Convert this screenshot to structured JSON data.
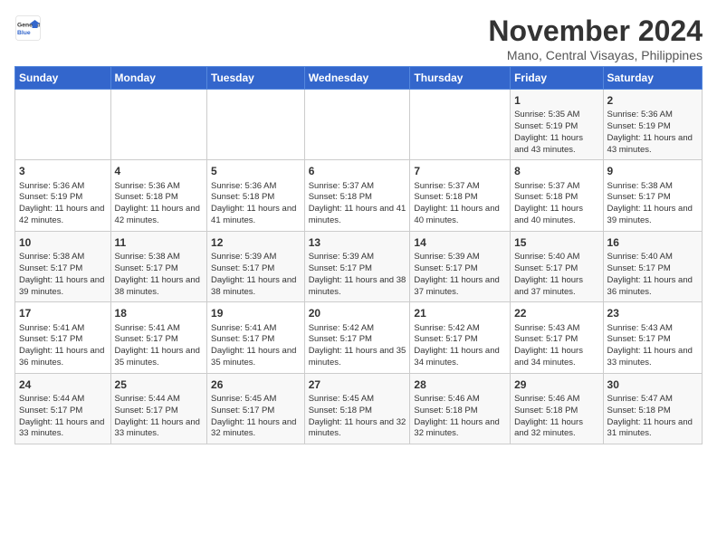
{
  "header": {
    "logo_text_general": "General",
    "logo_text_blue": "Blue",
    "month_title": "November 2024",
    "subtitle": "Mano, Central Visayas, Philippines"
  },
  "days_of_week": [
    "Sunday",
    "Monday",
    "Tuesday",
    "Wednesday",
    "Thursday",
    "Friday",
    "Saturday"
  ],
  "weeks": [
    [
      {
        "day": "",
        "info": ""
      },
      {
        "day": "",
        "info": ""
      },
      {
        "day": "",
        "info": ""
      },
      {
        "day": "",
        "info": ""
      },
      {
        "day": "",
        "info": ""
      },
      {
        "day": "1",
        "info": "Sunrise: 5:35 AM\nSunset: 5:19 PM\nDaylight: 11 hours and 43 minutes."
      },
      {
        "day": "2",
        "info": "Sunrise: 5:36 AM\nSunset: 5:19 PM\nDaylight: 11 hours and 43 minutes."
      }
    ],
    [
      {
        "day": "3",
        "info": "Sunrise: 5:36 AM\nSunset: 5:19 PM\nDaylight: 11 hours and 42 minutes."
      },
      {
        "day": "4",
        "info": "Sunrise: 5:36 AM\nSunset: 5:18 PM\nDaylight: 11 hours and 42 minutes."
      },
      {
        "day": "5",
        "info": "Sunrise: 5:36 AM\nSunset: 5:18 PM\nDaylight: 11 hours and 41 minutes."
      },
      {
        "day": "6",
        "info": "Sunrise: 5:37 AM\nSunset: 5:18 PM\nDaylight: 11 hours and 41 minutes."
      },
      {
        "day": "7",
        "info": "Sunrise: 5:37 AM\nSunset: 5:18 PM\nDaylight: 11 hours and 40 minutes."
      },
      {
        "day": "8",
        "info": "Sunrise: 5:37 AM\nSunset: 5:18 PM\nDaylight: 11 hours and 40 minutes."
      },
      {
        "day": "9",
        "info": "Sunrise: 5:38 AM\nSunset: 5:17 PM\nDaylight: 11 hours and 39 minutes."
      }
    ],
    [
      {
        "day": "10",
        "info": "Sunrise: 5:38 AM\nSunset: 5:17 PM\nDaylight: 11 hours and 39 minutes."
      },
      {
        "day": "11",
        "info": "Sunrise: 5:38 AM\nSunset: 5:17 PM\nDaylight: 11 hours and 38 minutes."
      },
      {
        "day": "12",
        "info": "Sunrise: 5:39 AM\nSunset: 5:17 PM\nDaylight: 11 hours and 38 minutes."
      },
      {
        "day": "13",
        "info": "Sunrise: 5:39 AM\nSunset: 5:17 PM\nDaylight: 11 hours and 38 minutes."
      },
      {
        "day": "14",
        "info": "Sunrise: 5:39 AM\nSunset: 5:17 PM\nDaylight: 11 hours and 37 minutes."
      },
      {
        "day": "15",
        "info": "Sunrise: 5:40 AM\nSunset: 5:17 PM\nDaylight: 11 hours and 37 minutes."
      },
      {
        "day": "16",
        "info": "Sunrise: 5:40 AM\nSunset: 5:17 PM\nDaylight: 11 hours and 36 minutes."
      }
    ],
    [
      {
        "day": "17",
        "info": "Sunrise: 5:41 AM\nSunset: 5:17 PM\nDaylight: 11 hours and 36 minutes."
      },
      {
        "day": "18",
        "info": "Sunrise: 5:41 AM\nSunset: 5:17 PM\nDaylight: 11 hours and 35 minutes."
      },
      {
        "day": "19",
        "info": "Sunrise: 5:41 AM\nSunset: 5:17 PM\nDaylight: 11 hours and 35 minutes."
      },
      {
        "day": "20",
        "info": "Sunrise: 5:42 AM\nSunset: 5:17 PM\nDaylight: 11 hours and 35 minutes."
      },
      {
        "day": "21",
        "info": "Sunrise: 5:42 AM\nSunset: 5:17 PM\nDaylight: 11 hours and 34 minutes."
      },
      {
        "day": "22",
        "info": "Sunrise: 5:43 AM\nSunset: 5:17 PM\nDaylight: 11 hours and 34 minutes."
      },
      {
        "day": "23",
        "info": "Sunrise: 5:43 AM\nSunset: 5:17 PM\nDaylight: 11 hours and 33 minutes."
      }
    ],
    [
      {
        "day": "24",
        "info": "Sunrise: 5:44 AM\nSunset: 5:17 PM\nDaylight: 11 hours and 33 minutes."
      },
      {
        "day": "25",
        "info": "Sunrise: 5:44 AM\nSunset: 5:17 PM\nDaylight: 11 hours and 33 minutes."
      },
      {
        "day": "26",
        "info": "Sunrise: 5:45 AM\nSunset: 5:17 PM\nDaylight: 11 hours and 32 minutes."
      },
      {
        "day": "27",
        "info": "Sunrise: 5:45 AM\nSunset: 5:18 PM\nDaylight: 11 hours and 32 minutes."
      },
      {
        "day": "28",
        "info": "Sunrise: 5:46 AM\nSunset: 5:18 PM\nDaylight: 11 hours and 32 minutes."
      },
      {
        "day": "29",
        "info": "Sunrise: 5:46 AM\nSunset: 5:18 PM\nDaylight: 11 hours and 32 minutes."
      },
      {
        "day": "30",
        "info": "Sunrise: 5:47 AM\nSunset: 5:18 PM\nDaylight: 11 hours and 31 minutes."
      }
    ]
  ]
}
